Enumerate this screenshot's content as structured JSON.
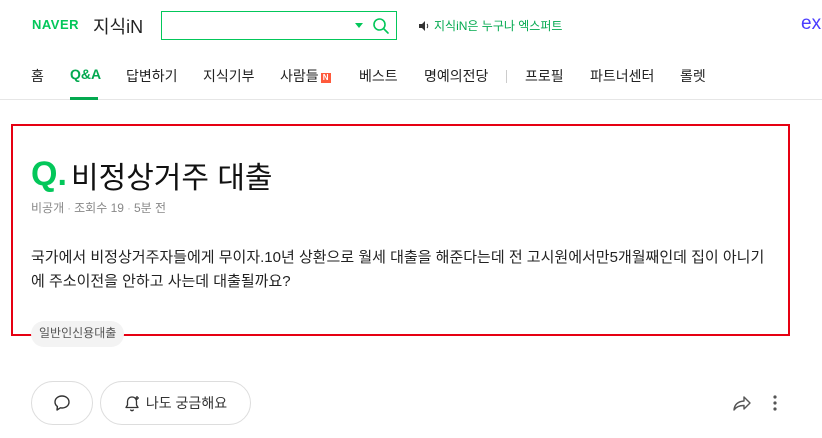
{
  "header": {
    "logo_naver": "NAVER",
    "logo_jisik": "지식iN",
    "search_value": "",
    "notice": "지식iN은 누구나 엑스퍼트",
    "ex_logo": "ex"
  },
  "nav": {
    "items": [
      {
        "label": "홈"
      },
      {
        "label": "Q&A"
      },
      {
        "label": "답변하기"
      },
      {
        "label": "지식기부"
      },
      {
        "label": "사람들"
      },
      {
        "label": "베스트"
      },
      {
        "label": "명예의전당"
      },
      {
        "label": "프로필"
      },
      {
        "label": "파트너센터"
      },
      {
        "label": "롤렛"
      }
    ],
    "badge": "N"
  },
  "question": {
    "q_mark": "Q.",
    "title": "비정상거주 대출",
    "author": "비공개",
    "views": "조회수 19",
    "time": "5분 전",
    "body": "국가에서 비정상거주자들에게 무이자.10년 상환으로 월세 대출을 해준다는데 전 고시원에서만5개월째인데 집이 아니기에 주소이전을 안하고 사는데 대출될까요?",
    "tag": "일반인신용대출"
  },
  "actions": {
    "curious_label": "나도 궁금해요"
  },
  "colors": {
    "brand_green": "#03c75a",
    "highlight_red": "#e60012"
  }
}
